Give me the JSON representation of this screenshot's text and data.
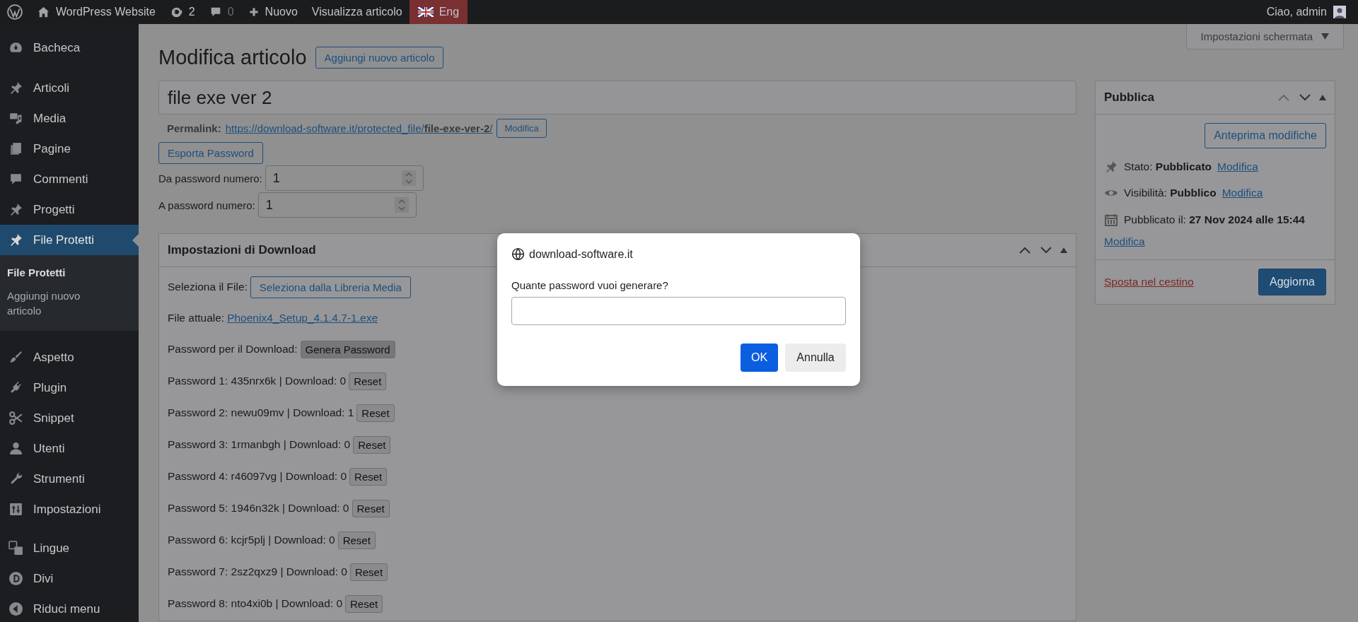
{
  "admin_bar": {
    "site_name": "WordPress Website",
    "updates": "2",
    "comments": "0",
    "new": "Nuovo",
    "view": "Visualizza articolo",
    "language": "Eng",
    "greeting": "Ciao, admin"
  },
  "sidebar": {
    "items": [
      {
        "label": "Bacheca",
        "selected": false
      },
      {
        "label": "Articoli",
        "selected": false
      },
      {
        "label": "Media",
        "selected": false
      },
      {
        "label": "Pagine",
        "selected": false
      },
      {
        "label": "Commenti",
        "selected": false
      },
      {
        "label": "Progetti",
        "selected": false
      },
      {
        "label": "File Protetti",
        "selected": true,
        "children": [
          {
            "label": "File Protetti",
            "selected": true
          },
          {
            "label": "Aggiungi nuovo articolo",
            "selected": false
          }
        ]
      },
      {
        "label": "Aspetto",
        "selected": false
      },
      {
        "label": "Plugin",
        "selected": false
      },
      {
        "label": "Snippet",
        "selected": false
      },
      {
        "label": "Utenti",
        "selected": false
      },
      {
        "label": "Strumenti",
        "selected": false
      },
      {
        "label": "Impostazioni",
        "selected": false
      },
      {
        "label": "Lingue",
        "selected": false
      },
      {
        "label": "Divi",
        "selected": false
      },
      {
        "label": "Riduci menu",
        "selected": false
      }
    ]
  },
  "screen_options": "Impostazioni schermata",
  "editor": {
    "heading": "Modifica articolo",
    "add_new": "Aggiungi nuovo articolo",
    "title_value": "file exe ver 2",
    "permalink_label": "Permalink:",
    "permalink_url": "https://download-software.it/protected_file/**file-exe-ver-2**/",
    "permalink_edit": "Modifica",
    "export_button": "Esporta Password",
    "range_fields": [
      {
        "label": "Da password numero:",
        "value": "1"
      },
      {
        "label": "A password numero:",
        "value": "1"
      }
    ]
  },
  "download_box": {
    "title": "Impostazioni di Download",
    "select_label": "Seleziona il File:",
    "select_button": "Seleziona dalla Libreria Media",
    "current_label": "File attuale:",
    "current_file": "Phoenix4_Setup_4.1.4.7-1.exe",
    "generate_label": "Password per il Download:",
    "generate_button": "Genera Password",
    "passwords": [
      {
        "text": "Password 1: 435nrx6k | Download: 0",
        "button": "Reset"
      },
      {
        "text": "Password 2: newu09mv | Download: 1",
        "button": "Reset"
      },
      {
        "text": "Password 3: 1rmanbgh | Download: 0",
        "button": "Reset"
      },
      {
        "text": "Password 4: r46097vg | Download: 0",
        "button": "Reset"
      },
      {
        "text": "Password 5: 1946n32k | Download: 0",
        "button": "Reset"
      },
      {
        "text": "Password 6: kcjr5plj | Download: 0",
        "button": "Reset"
      },
      {
        "text": "Password 7: 2sz2qxz9 | Download: 0",
        "button": "Reset"
      },
      {
        "text": "Password 8: nto4xi0b | Download: 0",
        "button": "Reset"
      }
    ]
  },
  "publish_box": {
    "title": "Pubblica",
    "preview_button": "Anteprima modifiche",
    "meta": [
      {
        "text": "Stato: **Pubblicato**",
        "link": "Modifica"
      },
      {
        "text": "Visibilità: **Pubblico**",
        "link": "Modifica"
      },
      {
        "text": "Pubblicato il: **27 Nov 2024 alle 15:44**",
        "link": "Modifica"
      }
    ],
    "trash_link": "Sposta nel cestino",
    "update_button": "Aggiorna"
  },
  "dialog": {
    "origin": "download-software.it",
    "message": "Quante password vuoi generare?",
    "ok": "OK",
    "cancel": "Annulla"
  }
}
